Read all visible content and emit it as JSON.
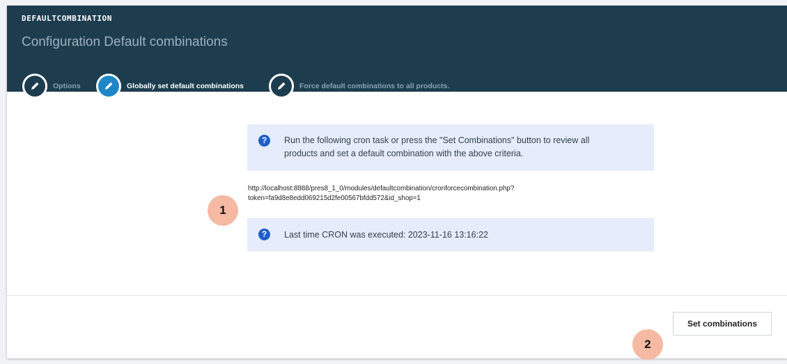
{
  "header": {
    "module_name": "DEFAULTCOMBINATION",
    "title": "Configuration Default combinations"
  },
  "tabs": [
    {
      "label": "Options",
      "icon": "pencil-icon",
      "active": false
    },
    {
      "label": "Globally set default combinations",
      "icon": "pencil-icon",
      "active": true
    },
    {
      "label": "Force default combinations to all products.",
      "icon": "pencil-icon",
      "active": false
    }
  ],
  "info": {
    "line1": "Run the following cron task or press the \"Set Combinations\" button to review all",
    "line2": "products and set a default combination with the above criteria.",
    "icon": "question-icon"
  },
  "cron": {
    "url_line1": "http://localhost:8888/pres8_1_0/modules/defaultcombination/cronforcecombination.php?",
    "url_line2": "token=fa9d8e8edd069215d2fe00567bfdd572&id_shop=1"
  },
  "last_run": {
    "text": "Last time CRON was executed: 2023-11-16 13:16:22",
    "icon": "question-icon"
  },
  "actions": {
    "set_combinations_label": "Set combinations"
  },
  "markers": [
    "1",
    "2"
  ],
  "colors": {
    "header_bg": "#1d3d4f",
    "active_tab": "#1f87c6",
    "info_bg": "#e6ecfb",
    "info_icon": "#1f5ec9",
    "marker": "#f6b9a3"
  }
}
